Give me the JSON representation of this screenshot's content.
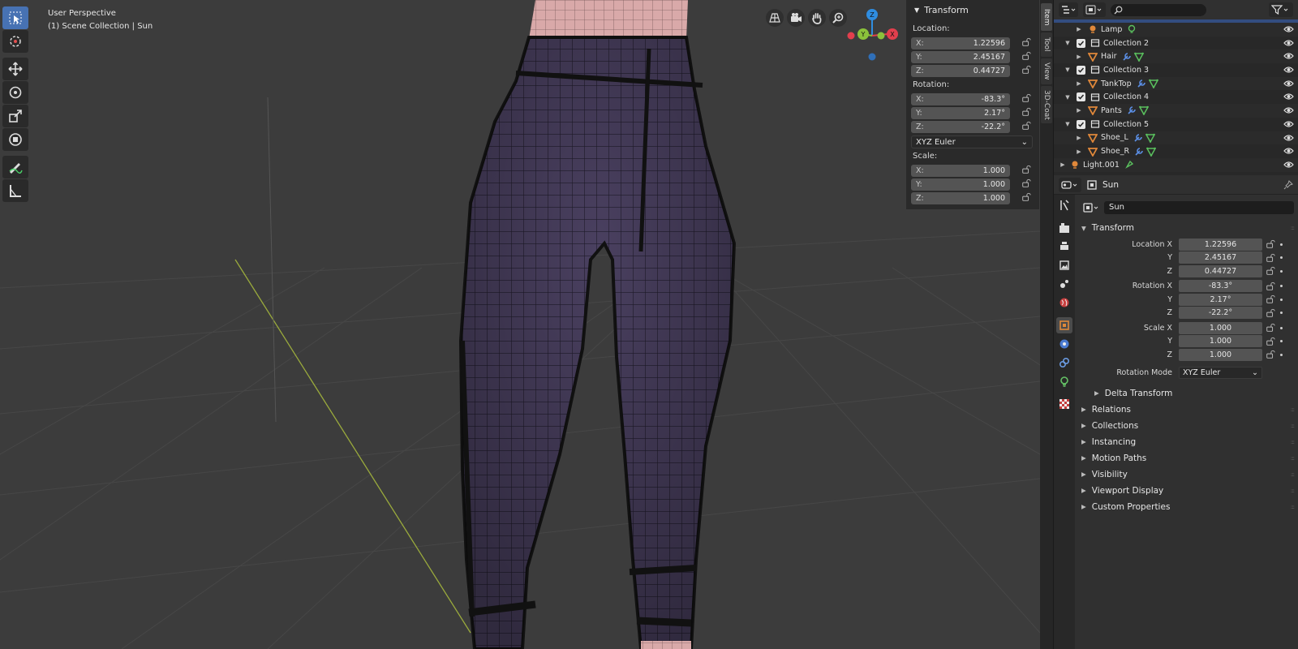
{
  "viewport": {
    "title": "User Perspective",
    "context": "(1) Scene Collection | Sun",
    "tools": [
      "select-box-icon",
      "cursor-icon",
      "move-icon",
      "rotate-icon",
      "scale-icon",
      "transform-icon",
      "annotate-icon",
      "measure-icon"
    ],
    "gizmo": {
      "z": "Z",
      "y": "Y",
      "x": "X"
    }
  },
  "npanel": {
    "title": "Transform",
    "location_label": "Location:",
    "location": [
      {
        "k": "X:",
        "v": "1.22596"
      },
      {
        "k": "Y:",
        "v": "2.45167"
      },
      {
        "k": "Z:",
        "v": "0.44727"
      }
    ],
    "rotation_label": "Rotation:",
    "rotation": [
      {
        "k": "X:",
        "v": "-83.3°"
      },
      {
        "k": "Y:",
        "v": "2.17°"
      },
      {
        "k": "Z:",
        "v": "-22.2°"
      }
    ],
    "rotation_mode": "XYZ Euler",
    "scale_label": "Scale:",
    "scale": [
      {
        "k": "X:",
        "v": "1.000"
      },
      {
        "k": "Y:",
        "v": "1.000"
      },
      {
        "k": "Z:",
        "v": "1.000"
      }
    ]
  },
  "sidetabs": [
    "Item",
    "Tool",
    "View",
    "3D-Coat"
  ],
  "outliner": {
    "rows": [
      {
        "name": "Lamp",
        "type": "light",
        "level": 2,
        "mod": "light"
      },
      {
        "name": "Collection 2",
        "type": "collection",
        "level": 1
      },
      {
        "name": "Hair",
        "type": "mesh",
        "level": 2,
        "mod": "mesh"
      },
      {
        "name": "Collection 3",
        "type": "collection",
        "level": 1
      },
      {
        "name": "TankTop",
        "type": "mesh",
        "level": 2,
        "mod": "mesh"
      },
      {
        "name": "Collection 4",
        "type": "collection",
        "level": 1
      },
      {
        "name": "Pants",
        "type": "mesh",
        "level": 2,
        "mod": "mesh"
      },
      {
        "name": "Collection 5",
        "type": "collection",
        "level": 1
      },
      {
        "name": "Shoe_L",
        "type": "mesh",
        "level": 2,
        "mod": "mesh"
      },
      {
        "name": "Shoe_R",
        "type": "mesh",
        "level": 2,
        "mod": "mesh"
      },
      {
        "name": "Light.001",
        "type": "light",
        "level": 0,
        "mod": "data"
      }
    ]
  },
  "properties": {
    "header_object": "Sun",
    "object_name": "Sun",
    "transform_title": "Transform",
    "rows": [
      {
        "label": "Location X",
        "value": "1.22596"
      },
      {
        "label": "Y",
        "value": "2.45167"
      },
      {
        "label": "Z",
        "value": "0.44727"
      },
      {
        "label": "Rotation X",
        "value": "-83.3°"
      },
      {
        "label": "Y",
        "value": "2.17°"
      },
      {
        "label": "Z",
        "value": "-22.2°"
      },
      {
        "label": "Scale X",
        "value": "1.000"
      },
      {
        "label": "Y",
        "value": "1.000"
      },
      {
        "label": "Z",
        "value": "1.000"
      }
    ],
    "rotation_mode_label": "Rotation Mode",
    "rotation_mode": "XYZ Euler",
    "delta": "Delta Transform",
    "panels": [
      "Relations",
      "Collections",
      "Instancing",
      "Motion Paths",
      "Visibility",
      "Viewport Display",
      "Custom Properties"
    ]
  },
  "colors": {
    "accent": "#4772b3",
    "mesh": "#e0883a",
    "collection": "#e6e6e6",
    "x_axis": "#e23f4d",
    "y_axis": "#8bc23b",
    "z_axis": "#2f8de0"
  }
}
